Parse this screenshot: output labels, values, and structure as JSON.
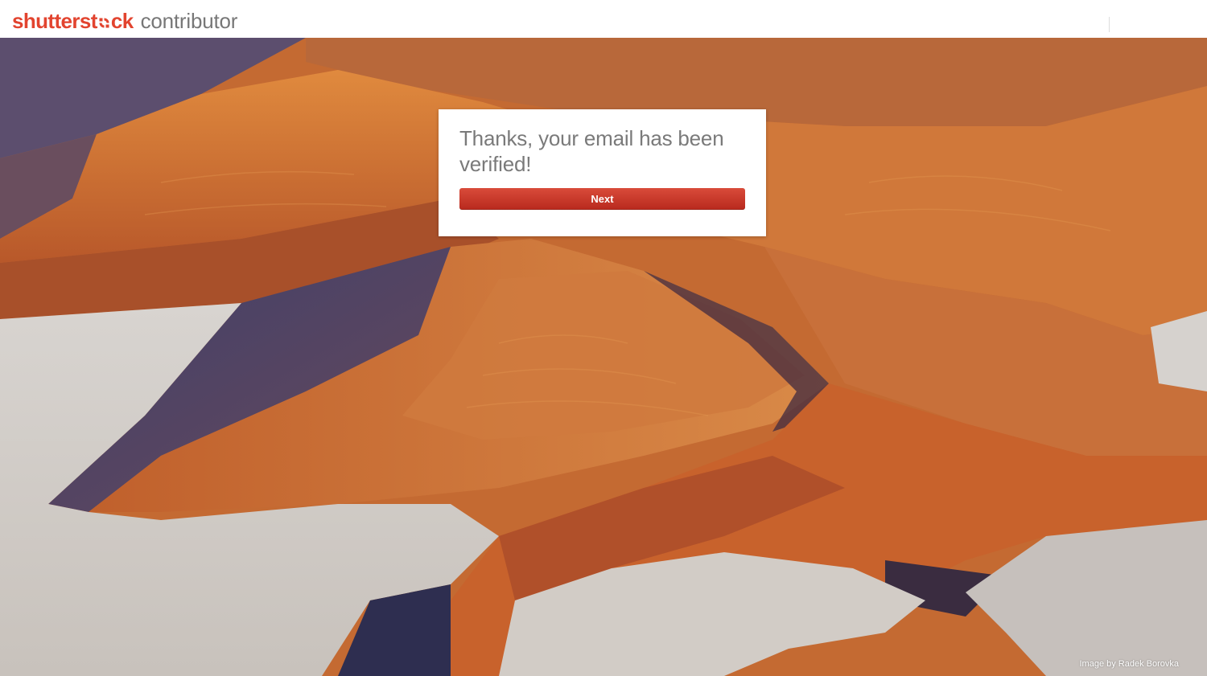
{
  "header": {
    "logo": {
      "brand_prefix": "shutterst",
      "brand_suffix": "ck",
      "sub": "contributor"
    }
  },
  "card": {
    "title": "Thanks, your email has been verified!",
    "next_label": "Next"
  },
  "footer": {
    "credit": "Image by Radek Borovka"
  },
  "colors": {
    "brand_red": "#e2442f",
    "button_red": "#c9352a",
    "text_gray": "#7a7a7a"
  }
}
